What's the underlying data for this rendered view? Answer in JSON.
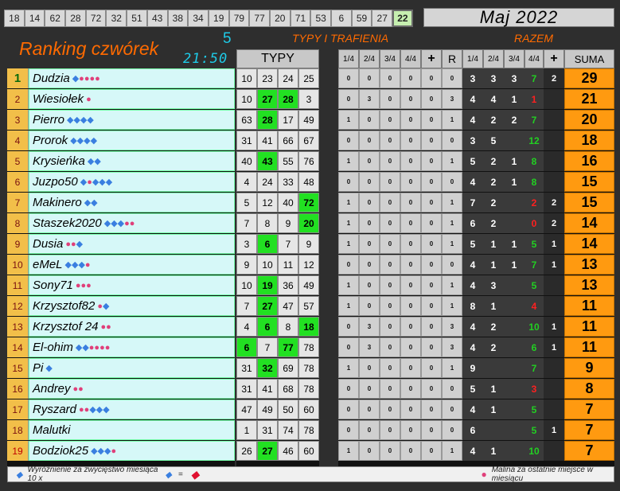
{
  "top_numbers": [
    "18",
    "14",
    "62",
    "28",
    "72",
    "32",
    "51",
    "43",
    "38",
    "34",
    "19",
    "79",
    "77",
    "20",
    "71",
    "53",
    "6",
    "59",
    "27",
    "22"
  ],
  "top_numbers_highlight_index": 19,
  "month_label": "Maj 2022",
  "title": "Ranking czwórek",
  "round_number": "5",
  "clock": "21:50",
  "section_typy_trafienia": "TYPY I TRAFIENIA",
  "section_razem": "RAZEM",
  "headers": {
    "typy": "TYPY",
    "q14": "1/4",
    "q24": "2/4",
    "q34": "3/4",
    "q44": "4/4",
    "plus": "+",
    "r": "R",
    "t14": "1/4",
    "t24": "2/4",
    "t34": "3/4",
    "t44": "4/4",
    "plus2": "+",
    "suma": "SUMA"
  },
  "colors": {
    "accent_orange": "#ff6a00",
    "clock_cyan": "#1ecbe8",
    "green_hit": "#22e022",
    "suma_orange": "#ff9a10"
  },
  "rows": [
    {
      "rank": "1",
      "name": "Dudzia",
      "icons": [
        {
          "k": "dm",
          "s": "◆"
        },
        {
          "k": "mal",
          "s": "●●●●"
        }
      ],
      "typy": [
        "10",
        "23",
        "24",
        "25"
      ],
      "g": [],
      "s": [
        "0",
        "0",
        "0",
        "0",
        "0",
        "0"
      ],
      "t": [
        "3",
        "3",
        "3",
        "7"
      ],
      "tc": [
        "",
        "",
        "",
        "g"
      ],
      "p": "2",
      "suma": "29"
    },
    {
      "rank": "2",
      "name": "Wiesiołek",
      "icons": [
        {
          "k": "mal",
          "s": "●"
        }
      ],
      "typy": [
        "10",
        "27",
        "28",
        "3"
      ],
      "g": [
        1,
        2
      ],
      "s": [
        "0",
        "3",
        "0",
        "0",
        "0",
        "3"
      ],
      "t": [
        "4",
        "4",
        "1",
        "1"
      ],
      "tc": [
        "",
        "",
        "",
        "r"
      ],
      "p": "",
      "suma": "21"
    },
    {
      "rank": "3",
      "name": "Pierro",
      "icons": [
        {
          "k": "dm",
          "s": "◆◆◆◆"
        }
      ],
      "typy": [
        "63",
        "28",
        "17",
        "49"
      ],
      "g": [
        1
      ],
      "s": [
        "1",
        "0",
        "0",
        "0",
        "0",
        "1"
      ],
      "t": [
        "4",
        "2",
        "2",
        "7"
      ],
      "tc": [
        "",
        "",
        "",
        "g"
      ],
      "p": "",
      "suma": "20"
    },
    {
      "rank": "4",
      "name": "Prorok",
      "icons": [
        {
          "k": "dm",
          "s": "◆◆◆◆"
        }
      ],
      "typy": [
        "31",
        "41",
        "66",
        "67"
      ],
      "g": [],
      "s": [
        "0",
        "0",
        "0",
        "0",
        "0",
        "0"
      ],
      "t": [
        "3",
        "5",
        "",
        "12"
      ],
      "tc": [
        "",
        "",
        "",
        "g"
      ],
      "p": "",
      "suma": "18"
    },
    {
      "rank": "5",
      "name": "Krysieńka",
      "icons": [
        {
          "k": "dm",
          "s": "◆◆"
        }
      ],
      "typy": [
        "40",
        "43",
        "55",
        "76"
      ],
      "g": [
        1
      ],
      "s": [
        "1",
        "0",
        "0",
        "0",
        "0",
        "1"
      ],
      "t": [
        "5",
        "2",
        "1",
        "8"
      ],
      "tc": [
        "",
        "",
        "",
        "g"
      ],
      "p": "",
      "suma": "16"
    },
    {
      "rank": "6",
      "name": "Juzpo50",
      "icons": [
        {
          "k": "dm",
          "s": "◆"
        },
        {
          "k": "mal",
          "s": "●"
        },
        {
          "k": "dm",
          "s": "◆◆◆"
        }
      ],
      "typy": [
        "4",
        "24",
        "33",
        "48"
      ],
      "g": [],
      "s": [
        "0",
        "0",
        "0",
        "0",
        "0",
        "0"
      ],
      "t": [
        "4",
        "2",
        "1",
        "8"
      ],
      "tc": [
        "",
        "",
        "",
        "g"
      ],
      "p": "",
      "suma": "15"
    },
    {
      "rank": "7",
      "name": "Makinero",
      "icons": [
        {
          "k": "dm",
          "s": "◆◆"
        }
      ],
      "typy": [
        "5",
        "12",
        "40",
        "72"
      ],
      "g": [
        3
      ],
      "s": [
        "1",
        "0",
        "0",
        "0",
        "0",
        "1"
      ],
      "t": [
        "7",
        "2",
        "",
        "2"
      ],
      "tc": [
        "",
        "",
        "",
        "r"
      ],
      "p": "2",
      "suma": "15"
    },
    {
      "rank": "8",
      "name": "Staszek2020",
      "icons": [
        {
          "k": "dm",
          "s": "◆◆◆"
        },
        {
          "k": "mal",
          "s": "●●"
        }
      ],
      "typy": [
        "7",
        "8",
        "9",
        "20"
      ],
      "g": [
        3
      ],
      "s": [
        "1",
        "0",
        "0",
        "0",
        "0",
        "1"
      ],
      "t": [
        "6",
        "2",
        "",
        "0"
      ],
      "tc": [
        "",
        "",
        "",
        "r"
      ],
      "p": "2",
      "suma": "14"
    },
    {
      "rank": "9",
      "name": "Dusia",
      "icons": [
        {
          "k": "mal",
          "s": "●●"
        },
        {
          "k": "dm",
          "s": "◆"
        }
      ],
      "typy": [
        "3",
        "6",
        "7",
        "9"
      ],
      "g": [
        1
      ],
      "s": [
        "1",
        "0",
        "0",
        "0",
        "0",
        "1"
      ],
      "t": [
        "5",
        "1",
        "1",
        "5"
      ],
      "tc": [
        "",
        "",
        "",
        "g"
      ],
      "p": "1",
      "suma": "14"
    },
    {
      "rank": "10",
      "name": "eMeL",
      "icons": [
        {
          "k": "dm",
          "s": "◆◆◆"
        },
        {
          "k": "mal",
          "s": "●"
        }
      ],
      "typy": [
        "9",
        "10",
        "11",
        "12"
      ],
      "g": [],
      "s": [
        "0",
        "0",
        "0",
        "0",
        "0",
        "0"
      ],
      "t": [
        "4",
        "1",
        "1",
        "7"
      ],
      "tc": [
        "",
        "",
        "",
        "g"
      ],
      "p": "1",
      "suma": "13"
    },
    {
      "rank": "11",
      "name": "Sony71",
      "icons": [
        {
          "k": "mal",
          "s": "●●●"
        }
      ],
      "typy": [
        "10",
        "19",
        "36",
        "49"
      ],
      "g": [
        1
      ],
      "s": [
        "1",
        "0",
        "0",
        "0",
        "0",
        "1"
      ],
      "t": [
        "4",
        "3",
        "",
        "5"
      ],
      "tc": [
        "",
        "",
        "",
        "g"
      ],
      "p": "",
      "suma": "13"
    },
    {
      "rank": "12",
      "name": "Krzysztof82",
      "icons": [
        {
          "k": "mal",
          "s": "●"
        },
        {
          "k": "dm",
          "s": "◆"
        }
      ],
      "typy": [
        "7",
        "27",
        "47",
        "57"
      ],
      "g": [
        1
      ],
      "s": [
        "1",
        "0",
        "0",
        "0",
        "0",
        "1"
      ],
      "t": [
        "8",
        "1",
        "",
        "4"
      ],
      "tc": [
        "",
        "",
        "",
        "r"
      ],
      "p": "",
      "suma": "11"
    },
    {
      "rank": "13",
      "name": "Krzysztof 24",
      "icons": [
        {
          "k": "mal",
          "s": "●●"
        }
      ],
      "typy": [
        "4",
        "6",
        "8",
        "18"
      ],
      "g": [
        1,
        3
      ],
      "s": [
        "0",
        "3",
        "0",
        "0",
        "0",
        "3"
      ],
      "t": [
        "4",
        "2",
        "",
        "10"
      ],
      "tc": [
        "",
        "",
        "",
        "g"
      ],
      "p": "1",
      "suma": "11"
    },
    {
      "rank": "14",
      "name": "El-ohim",
      "icons": [
        {
          "k": "dm",
          "s": "◆◆"
        },
        {
          "k": "mal",
          "s": "●●●●"
        }
      ],
      "typy": [
        "6",
        "7",
        "77",
        "78"
      ],
      "g": [
        0,
        2
      ],
      "s": [
        "0",
        "3",
        "0",
        "0",
        "0",
        "3"
      ],
      "t": [
        "4",
        "2",
        "",
        "6"
      ],
      "tc": [
        "",
        "",
        "",
        "g"
      ],
      "p": "1",
      "suma": "11"
    },
    {
      "rank": "15",
      "name": "Pi",
      "icons": [
        {
          "k": "dm",
          "s": "◆"
        }
      ],
      "typy": [
        "31",
        "32",
        "69",
        "78"
      ],
      "g": [
        1
      ],
      "s": [
        "1",
        "0",
        "0",
        "0",
        "0",
        "1"
      ],
      "t": [
        "9",
        "",
        "",
        "7"
      ],
      "tc": [
        "",
        "",
        "",
        "g"
      ],
      "p": "",
      "suma": "9"
    },
    {
      "rank": "16",
      "name": "Andrey",
      "icons": [
        {
          "k": "mal",
          "s": "●●"
        }
      ],
      "typy": [
        "31",
        "41",
        "68",
        "78"
      ],
      "g": [],
      "s": [
        "0",
        "0",
        "0",
        "0",
        "0",
        "0"
      ],
      "t": [
        "5",
        "1",
        "",
        "3"
      ],
      "tc": [
        "",
        "",
        "",
        "r"
      ],
      "p": "",
      "suma": "8"
    },
    {
      "rank": "17",
      "name": "Ryszard",
      "icons": [
        {
          "k": "mal",
          "s": "●●"
        },
        {
          "k": "dm",
          "s": "◆◆◆"
        }
      ],
      "typy": [
        "47",
        "49",
        "50",
        "60"
      ],
      "g": [],
      "s": [
        "0",
        "0",
        "0",
        "0",
        "0",
        "0"
      ],
      "t": [
        "4",
        "1",
        "",
        "5"
      ],
      "tc": [
        "",
        "",
        "",
        "g"
      ],
      "p": "",
      "suma": "7"
    },
    {
      "rank": "18",
      "name": "Malutki",
      "icons": [],
      "typy": [
        "1",
        "31",
        "74",
        "78"
      ],
      "g": [],
      "s": [
        "0",
        "0",
        "0",
        "0",
        "0",
        "0"
      ],
      "t": [
        "6",
        "",
        "",
        "5"
      ],
      "tc": [
        "",
        "",
        "",
        "g"
      ],
      "p": "1",
      "suma": "7"
    },
    {
      "rank": "19",
      "name": "Bodziok25",
      "icons": [
        {
          "k": "dm",
          "s": "◆◆◆"
        },
        {
          "k": "mal",
          "s": "●"
        }
      ],
      "typy": [
        "26",
        "27",
        "46",
        "60"
      ],
      "g": [
        1
      ],
      "s": [
        "1",
        "0",
        "0",
        "0",
        "0",
        "1"
      ],
      "t": [
        "4",
        "1",
        "",
        "10"
      ],
      "tc": [
        "",
        "",
        "",
        "g"
      ],
      "p": "",
      "suma": "7"
    }
  ],
  "footer": {
    "left_text": "Wyróżnienie za zwycięstwo miesiąca  10 x",
    "eq": "=",
    "right_text": "Malina za ostatnie miejsce w miesiącu"
  }
}
